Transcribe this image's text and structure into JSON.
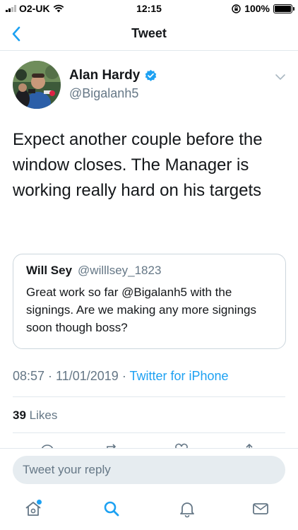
{
  "status_bar": {
    "carrier": "O2-UK",
    "time": "12:15",
    "battery_percent": "100%",
    "battery_level": 1.0
  },
  "nav": {
    "title": "Tweet",
    "back_icon": "chevron-left-icon"
  },
  "tweet": {
    "author_name": "Alan Hardy",
    "author_handle": "@Bigalanh5",
    "verified_icon": "verified-badge-icon",
    "text": "Expect another couple before the window closes. The Manager is working really hard on his targets",
    "time": "08:57",
    "date": "11/01/2019",
    "separator": " · ",
    "source": "Twitter for iPhone",
    "likes_count": "39",
    "likes_label": "Likes"
  },
  "quoted_tweet": {
    "author_name": "Will Sey",
    "author_handle": "@willlsey_1823",
    "text": "Great work so far @Bigalanh5  with the signings. Are we making any more signings soon though boss?"
  },
  "reply": {
    "placeholder": "Tweet your reply"
  },
  "tab_bar": {
    "items": [
      "home-icon",
      "search-icon",
      "notifications-icon",
      "messages-icon"
    ]
  },
  "colors": {
    "accent": "#1da1f2",
    "text": "#14171a",
    "secondary": "#657786",
    "border": "#e1e8ed"
  }
}
